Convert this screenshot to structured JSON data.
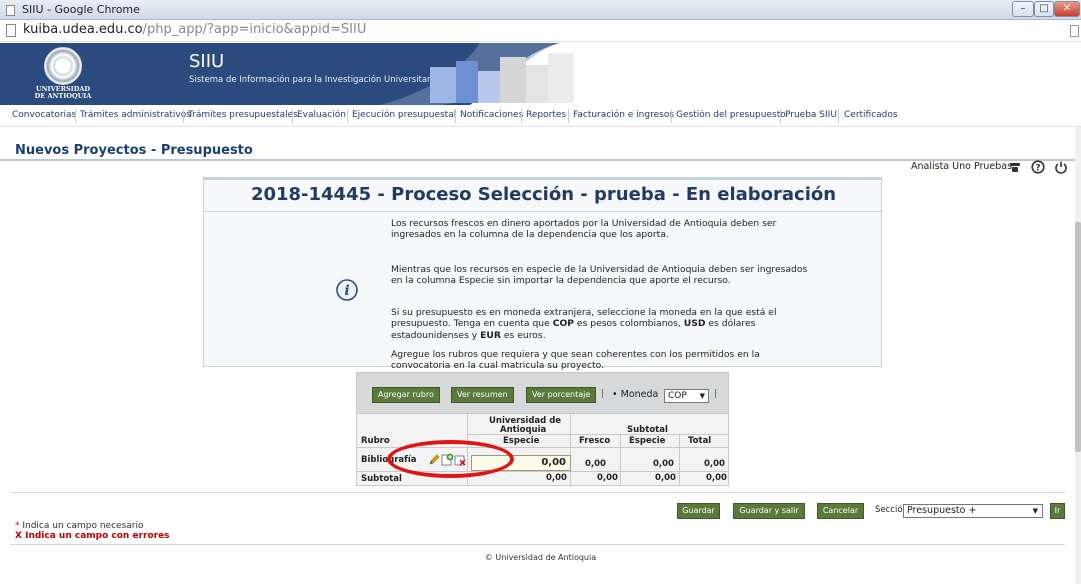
{
  "window": {
    "title": "SIIU - Google Chrome",
    "url_host": "kuiba.udea.edu.co",
    "url_path": "/php_app/?app=inicio&appid=SIIU",
    "min_glyph": "–",
    "max_glyph": "□",
    "close_glyph": "✕"
  },
  "banner": {
    "university_line1": "UNIVERSIDAD",
    "university_line2": "DE ANTIOQUIA",
    "app_name": "SIIU",
    "app_subtitle": "Sistema de Información para la Investigación Universitaria"
  },
  "menu": [
    "Convocatorias",
    "Trámites administrativos",
    "Trámites presupuestales",
    "Evaluación",
    "Ejecución presupuestal",
    "Notificaciones",
    "Reportes",
    "Facturación e ingresos",
    "Gestión del presupuesto",
    "Prueba SIIU",
    "Certificados"
  ],
  "page_title": "Nuevos Proyectos - Presupuesto",
  "user": {
    "name": "Analista Uno Pruebas"
  },
  "info": {
    "heading": "2018-14445 - Proceso Selección - prueba - En elaboración",
    "p1": "Los recursos frescos en dinero aportados por la Universidad de Antioquia deben ser ingresados en la columna de la dependencia que los aporta.",
    "p2": "Mientras que los recursos en especie de la Universidad de Antioquia deben ser ingresados en la columna Especie sin importar la dependencia que aporte el recurso.",
    "p3_a": "Si su presupuesto es en moneda extranjera, seleccione la moneda en la que está el presupuesto. Tenga en cuenta que ",
    "p3_cop": "COP",
    "p3_b": " es pesos colombianos, ",
    "p3_usd": "USD",
    "p3_c": " es dólares estadounidenses y ",
    "p3_eur": "EUR",
    "p3_d": " es euros.",
    "p4": "Agregue los rubros que requiera y que sean coherentes con los permitidos en la convocatoria en la cual matricula su proyecto."
  },
  "budget": {
    "buttons": {
      "add": "Agregar rubro",
      "summary": "Ver resumen",
      "percent": "Ver porcentaje"
    },
    "sep": "|",
    "currency_label": "• Moneda",
    "currency_value": "COP",
    "headers": {
      "ua_line1": "Universidad de",
      "ua_line2": "Antioquia",
      "subtotal_group": "Subtotal",
      "rubro": "Rubro",
      "especie": "Especie",
      "fresco": "Fresco",
      "especie2": "Especie",
      "total": "Total"
    },
    "rows": [
      {
        "rubro": "Bibliografía",
        "especie": "0,00",
        "fresco": "0,00",
        "especie_sub": "0,00",
        "total": "0,00"
      }
    ],
    "subtotal": {
      "label": "Subtotal",
      "especie": "0,00",
      "fresco": "0,00",
      "especie_sub": "0,00",
      "total": "0,00"
    }
  },
  "actions": {
    "save": "Guardar",
    "save_exit": "Guardar y salir",
    "cancel": "Cancelar",
    "section_label": "Sección",
    "section_value": "Presupuesto +",
    "go": "Ir"
  },
  "notes": {
    "required_mark": "*",
    "required": " Indica un campo necesario",
    "error_mark": "X",
    "error": "Indica un campo con errores"
  },
  "footer": "© Universidad de Antioquia",
  "colors": {
    "brand_blue": "#233a63",
    "button_green": "#5a7a3c",
    "highlight_red": "#e11414"
  }
}
